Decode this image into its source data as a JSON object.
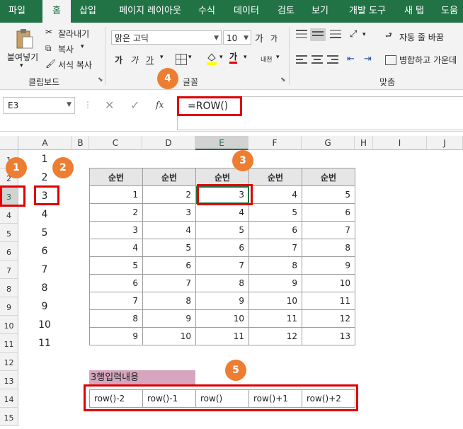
{
  "tabs": [
    "파일",
    "홈",
    "삽입",
    "페이지 레이아웃",
    "수식",
    "데이터",
    "검토",
    "보기",
    "개발 도구",
    "새 탭",
    "도움"
  ],
  "ribbon": {
    "paste": "붙여넣기",
    "cut": "잘라내기",
    "copy": "복사",
    "format_painter": "서식 복사",
    "clipboard_group": "클립보드",
    "font_name": "맑은 고딕",
    "font_size": "10",
    "grow_font": "가",
    "shrink_font": "가",
    "bold": "가",
    "italic": "가",
    "underline": "가",
    "font_color_glyph": "가",
    "phonetic": "내천",
    "font_group": "글꼴",
    "wrap_text": "자동 줄 바꿈",
    "merge_center": "병합하고 가운데",
    "align_group": "맞춤"
  },
  "formula_bar": {
    "name_box": "E3",
    "fx": "fx",
    "formula": "=ROW()"
  },
  "columns": [
    "A",
    "B",
    "C",
    "D",
    "E",
    "F",
    "G",
    "H",
    "I",
    "J"
  ],
  "row_numbers": [
    "1",
    "2",
    "3",
    "4",
    "5",
    "6",
    "7",
    "8",
    "9",
    "10",
    "11",
    "12",
    "13",
    "14",
    "15"
  ],
  "col_a_values": [
    "1",
    "2",
    "3",
    "4",
    "5",
    "6",
    "7",
    "8",
    "9",
    "10",
    "11"
  ],
  "table": {
    "headers": [
      "순번",
      "순번",
      "순번",
      "순번",
      "순번"
    ],
    "rows": [
      [
        "1",
        "2",
        "3",
        "4",
        "5"
      ],
      [
        "2",
        "3",
        "4",
        "5",
        "6"
      ],
      [
        "3",
        "4",
        "5",
        "6",
        "7"
      ],
      [
        "4",
        "5",
        "6",
        "7",
        "8"
      ],
      [
        "5",
        "6",
        "7",
        "8",
        "9"
      ],
      [
        "6",
        "7",
        "8",
        "9",
        "10"
      ],
      [
        "7",
        "8",
        "9",
        "10",
        "11"
      ],
      [
        "8",
        "9",
        "10",
        "11",
        "12"
      ],
      [
        "9",
        "10",
        "11",
        "12",
        "13"
      ]
    ]
  },
  "row13_label": "3행입력내용",
  "row14_cells": [
    "row()-2",
    "row()-1",
    "row()",
    "row()+1",
    "row()+2"
  ],
  "callouts": [
    "1",
    "2",
    "3",
    "4",
    "5"
  ],
  "colors": {
    "excel_green": "#217346",
    "callout": "#ed7d31",
    "highlight": "#e00000",
    "label_fill": "#d5a6bd",
    "header_fill": "#e7e6e6"
  }
}
